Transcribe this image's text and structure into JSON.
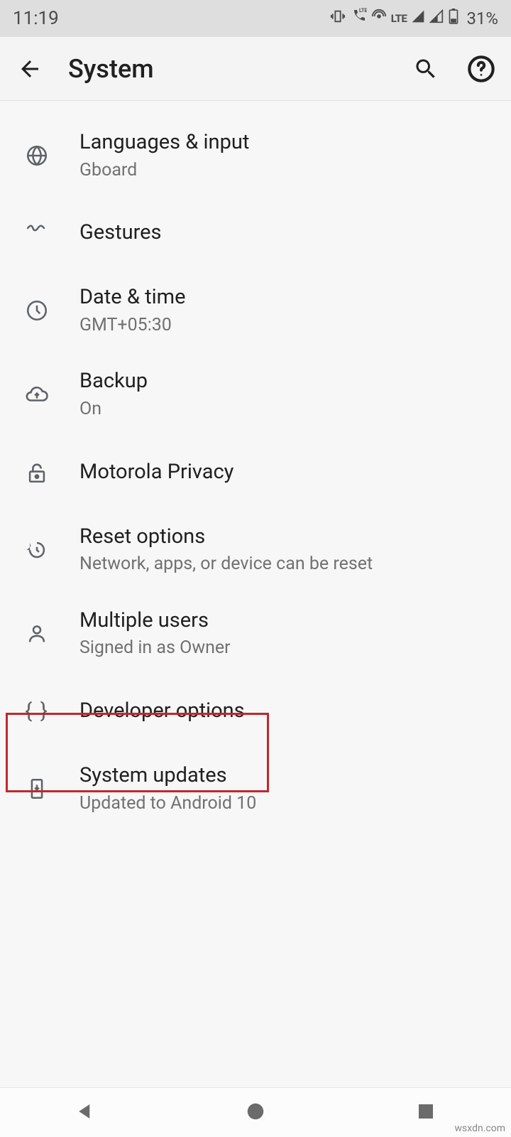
{
  "status": {
    "time": "11:19",
    "network": "LTE",
    "battery": "31%"
  },
  "header": {
    "title": "System"
  },
  "items": [
    {
      "title": "Languages & input",
      "sub": "Gboard",
      "icon": "globe"
    },
    {
      "title": "Gestures",
      "sub": "",
      "icon": "gesture"
    },
    {
      "title": "Date & time",
      "sub": "GMT+05:30",
      "icon": "clock"
    },
    {
      "title": "Backup",
      "sub": "On",
      "icon": "cloud-up"
    },
    {
      "title": "Motorola Privacy",
      "sub": "",
      "icon": "unlock"
    },
    {
      "title": "Reset options",
      "sub": "Network, apps, or device can be reset",
      "icon": "reset"
    },
    {
      "title": "Multiple users",
      "sub": "Signed in as Owner",
      "icon": "person"
    },
    {
      "title": "Developer options",
      "sub": "",
      "icon": "braces"
    },
    {
      "title": "System updates",
      "sub": "Updated to Android 10",
      "icon": "phone-down"
    }
  ],
  "watermark": "wsxdn.com"
}
